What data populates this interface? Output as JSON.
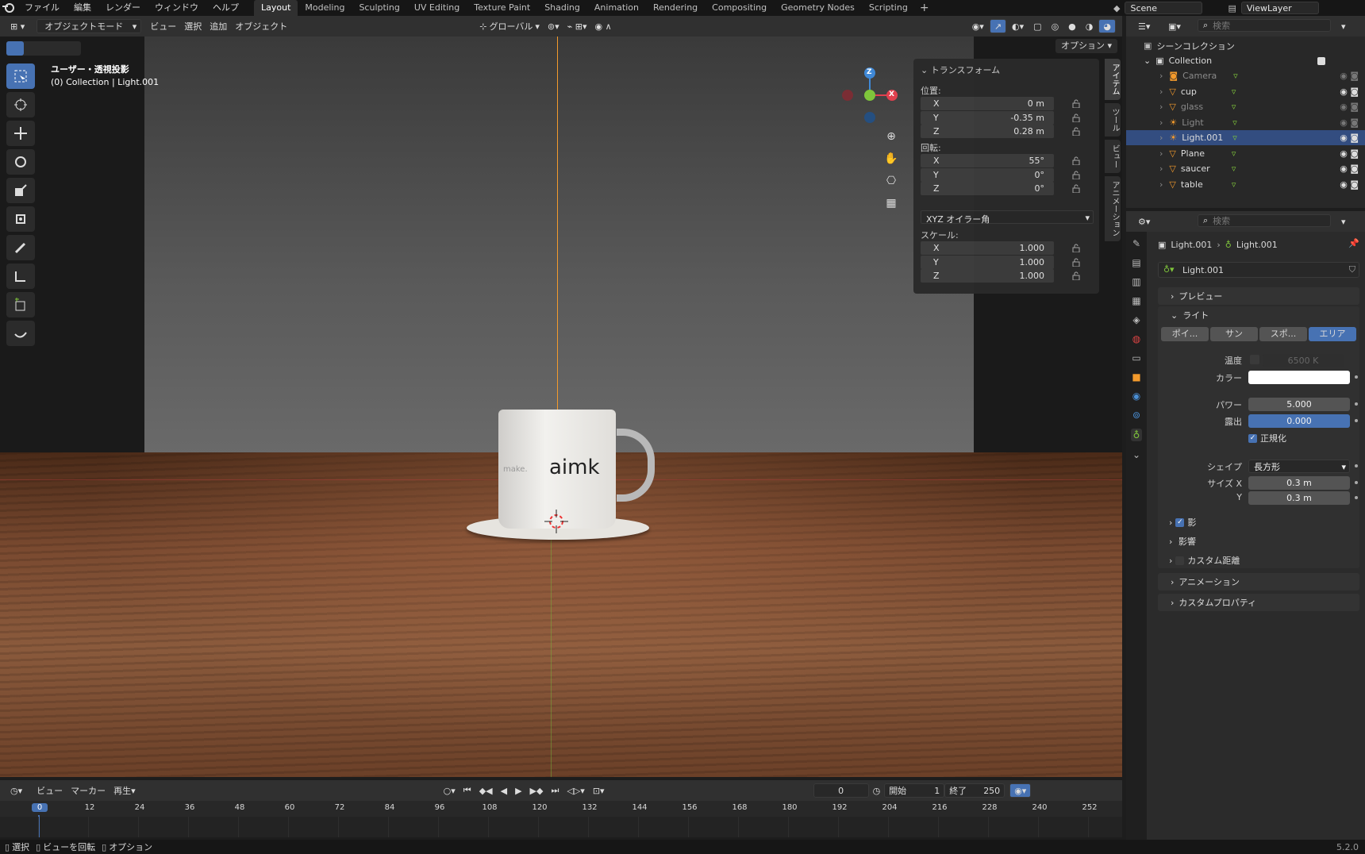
{
  "menu": {
    "file": "ファイル",
    "edit": "編集",
    "render": "レンダー",
    "window": "ウィンドウ",
    "help": "ヘルプ"
  },
  "workspaces": [
    "Layout",
    "Modeling",
    "Sculpting",
    "UV Editing",
    "Texture Paint",
    "Shading",
    "Animation",
    "Rendering",
    "Compositing",
    "Geometry Nodes",
    "Scripting"
  ],
  "active_workspace": "Layout",
  "scene": "Scene",
  "view_layer": "ViewLayer",
  "viewport_header": {
    "mode": "オブジェクトモード",
    "view": "ビュー",
    "select": "選択",
    "add": "追加",
    "object": "オブジェクト",
    "orientation": "グローバル",
    "options": "オプション"
  },
  "viewport": {
    "view_label": "ユーザー・透視投影",
    "context": "(0) Collection | Light.001"
  },
  "npanel": {
    "title": "トランスフォーム",
    "location_label": "位置:",
    "location": [
      {
        "axis": "X",
        "value": "0 m"
      },
      {
        "axis": "Y",
        "value": "-0.35 m"
      },
      {
        "axis": "Z",
        "value": "0.28 m"
      }
    ],
    "rotation_label": "回転:",
    "rotation": [
      {
        "axis": "X",
        "value": "55°"
      },
      {
        "axis": "Y",
        "value": "0°"
      },
      {
        "axis": "Z",
        "value": "0°"
      }
    ],
    "rotation_mode": "XYZ オイラー角",
    "scale_label": "スケール:",
    "scale": [
      {
        "axis": "X",
        "value": "1.000"
      },
      {
        "axis": "Y",
        "value": "1.000"
      },
      {
        "axis": "Z",
        "value": "1.000"
      }
    ],
    "tabs": [
      "アイテム",
      "ツール",
      "ビュー",
      "アニメーション"
    ]
  },
  "mug_text": {
    "brand": "aimk",
    "small": "make."
  },
  "gizmo": {
    "x": "X",
    "y": "Y",
    "z": "Z"
  },
  "timeline": {
    "view": "ビュー",
    "marker": "マーカー",
    "playback": "再生",
    "current": "0",
    "start_label": "開始",
    "start": "1",
    "end_label": "終了",
    "end": "250",
    "ticks": [
      "0",
      "12",
      "24",
      "36",
      "48",
      "60",
      "72",
      "84",
      "96",
      "108",
      "120",
      "132",
      "144",
      "156",
      "168",
      "180",
      "192",
      "204",
      "216",
      "228",
      "240",
      "252"
    ]
  },
  "status": {
    "select": "選択",
    "rotate": "ビューを回転",
    "options": "オプション",
    "version": "5.2.0"
  },
  "outliner": {
    "search_placeholder": "検索",
    "scene_collection": "シーンコレクション",
    "collection": "Collection",
    "items": [
      {
        "name": "Camera",
        "dim": true
      },
      {
        "name": "cup",
        "dim": false
      },
      {
        "name": "glass",
        "dim": true
      },
      {
        "name": "Light",
        "dim": true
      },
      {
        "name": "Light.001",
        "dim": false,
        "selected": true
      },
      {
        "name": "Plane",
        "dim": false
      },
      {
        "name": "saucer",
        "dim": false
      },
      {
        "name": "table",
        "dim": false
      }
    ]
  },
  "properties": {
    "search_placeholder": "検索",
    "breadcrumb_obj": "Light.001",
    "breadcrumb_data": "Light.001",
    "datablock": "Light.001",
    "preview": "プレビュー",
    "light": "ライト",
    "types": [
      "ポイ...",
      "サン",
      "スポ...",
      "エリア"
    ],
    "active_type": "エリア",
    "temperature_label": "温度",
    "temperature": "6500 K",
    "color_label": "カラー",
    "power_label": "パワー",
    "power": "5.000",
    "exposure_label": "露出",
    "exposure": "0.000",
    "normalize": "正規化",
    "shape_label": "シェイプ",
    "shape": "長方形",
    "size_x_label": "サイズ X",
    "size_x": "0.3 m",
    "size_y_label": "Y",
    "size_y": "0.3 m",
    "shadow": "影",
    "influence": "影響",
    "custom_distance": "カスタム距離",
    "animation": "アニメーション",
    "custom_props": "カスタムプロパティ"
  },
  "colors": {
    "accent": "#4772b3",
    "selected": "#334d80",
    "x_axis": "#e0404e",
    "y_axis": "#7fc53b",
    "z_axis": "#3f88d6",
    "orange": "#f39a2c"
  }
}
